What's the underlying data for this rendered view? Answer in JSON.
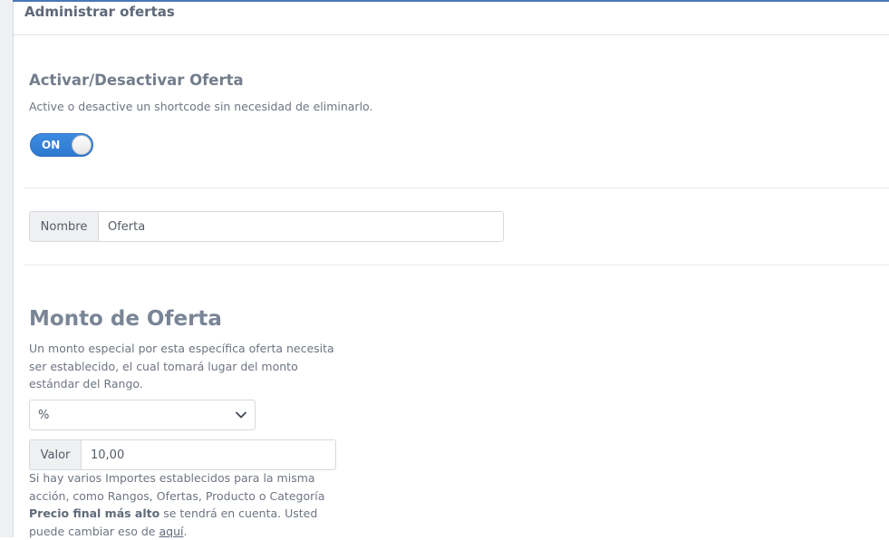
{
  "header": {
    "title": "Administrar ofertas"
  },
  "activate_section": {
    "title": "Activar/Desactivar Oferta",
    "description": "Active o desactive un shortcode sin necesidad de eliminarlo.",
    "toggle_label": "ON",
    "toggle_state": "on"
  },
  "name_field": {
    "label": "Nombre",
    "value": "Oferta"
  },
  "amount_section": {
    "title": "Monto de Oferta",
    "description": "Un monto especial por esta específica oferta necesita ser establecido, el cual tomará lugar del monto estándar del Rango.",
    "type_select": {
      "selected": "%"
    },
    "value_field": {
      "label": "Valor",
      "value": "10,00"
    },
    "note": {
      "part1": "Si hay varios Importes establecidos para la misma acción, como Rangos, Ofertas, Producto o Categoría ",
      "bold": "Precio final más alto",
      "part2": " se tendrá en cuenta. Usted puede cambiar eso de ",
      "link": "aquí",
      "end": "."
    }
  },
  "colors": {
    "accent": "#2e79d0",
    "title": "#737d8c",
    "text": "#6e7582",
    "border": "#d6d9de",
    "addon_bg": "#eef0f2"
  },
  "icons": {
    "select_arrow": "chevron-down-icon"
  }
}
